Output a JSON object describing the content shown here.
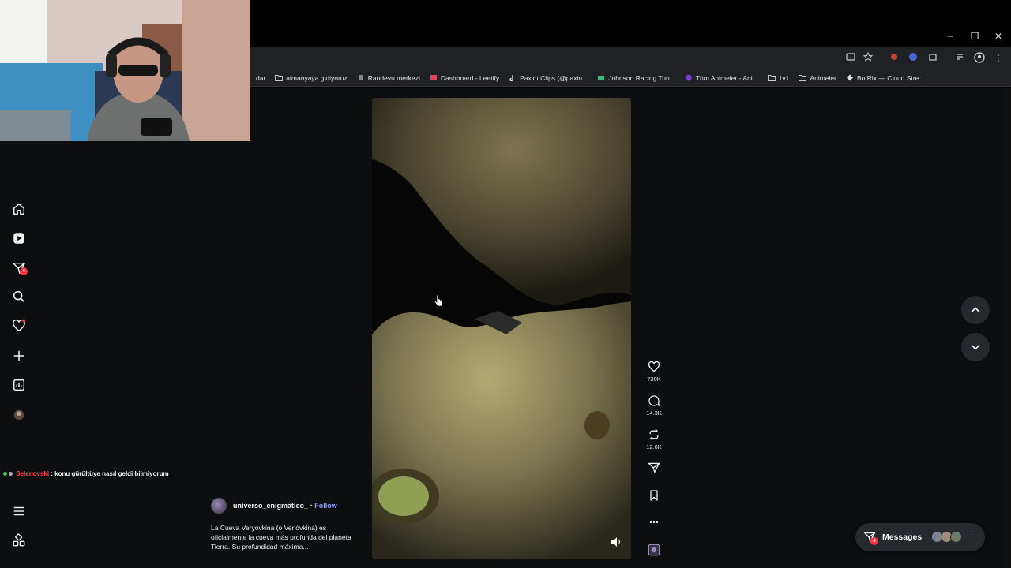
{
  "window": {
    "controls": {
      "minimize": "─",
      "restore": "❐",
      "close": "✕"
    }
  },
  "bookmarks": [
    {
      "label": "dar",
      "icon": "none"
    },
    {
      "label": "almanyaya gidiyoruz",
      "icon": "folder-icon"
    },
    {
      "label": "Randevu merkezi",
      "icon": "site-icon"
    },
    {
      "label": "Dashboard - Leetify",
      "icon": "site-icon"
    },
    {
      "label": "Paxint Clips (@paxin...",
      "icon": "tiktok-icon"
    },
    {
      "label": "Johnson Racing Tun...",
      "icon": "site-icon"
    },
    {
      "label": "Tüm Animeler - Ani...",
      "icon": "site-icon"
    },
    {
      "label": "1v1",
      "icon": "folder-icon"
    },
    {
      "label": "Animeler",
      "icon": "folder-icon"
    },
    {
      "label": "BotRix — Cloud Stre...",
      "icon": "site-icon"
    }
  ],
  "sidebar": {
    "messages_badge": "4"
  },
  "chat": {
    "user": "Selenovski",
    "separator": " :",
    "message": " konu gürültüye nasıl geldi bilmiyorum",
    "user_color": "#ff4a4a"
  },
  "post": {
    "username": "universo_enigmatico_",
    "bullet": "•",
    "follow": "Follow",
    "caption": "La Cueva Veryovkina (o Veriόvkina) es oficialmente la cueva más profunda del planeta Tierra. Su profundidad máxima...",
    "actions": {
      "likes": "730K",
      "comments": "14.3K",
      "reposts": "12.6K"
    }
  },
  "messages_pill": {
    "label": "Messages",
    "badge": "4",
    "more": "···"
  },
  "colors": {
    "accent_badge": "#ff3040",
    "follow": "#8c9bff",
    "page_bg": "#0c0e10"
  }
}
